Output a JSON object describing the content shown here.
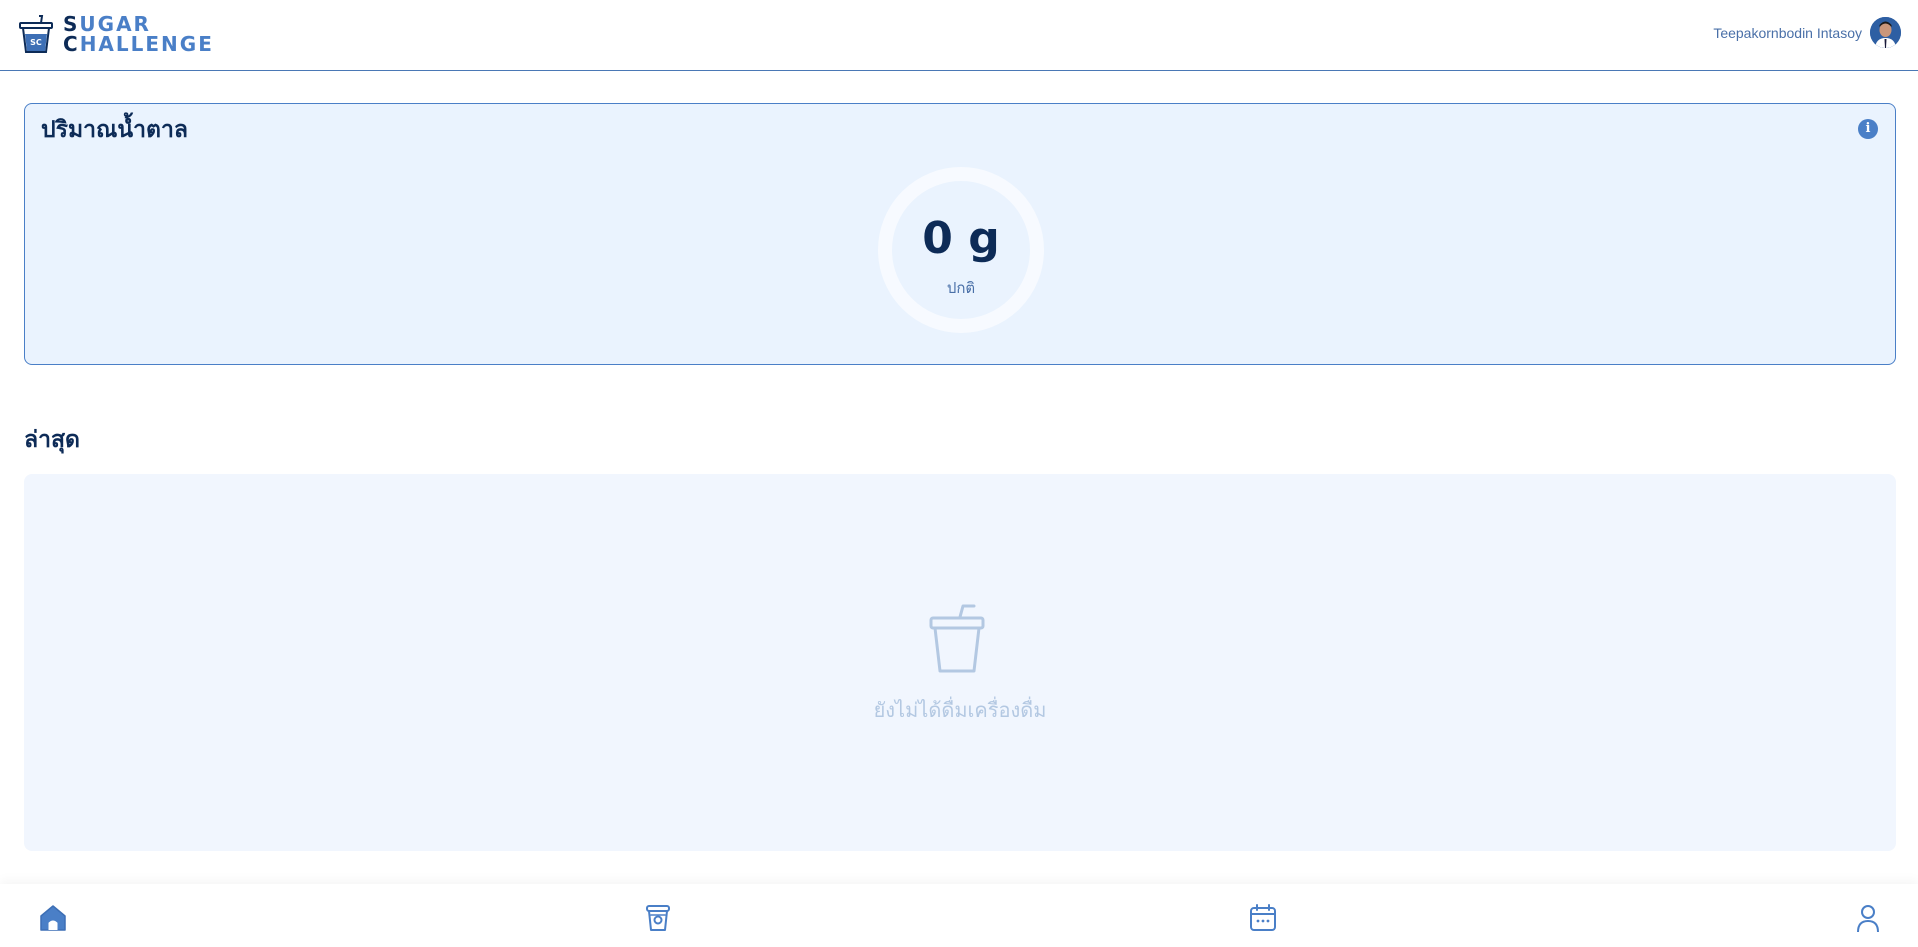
{
  "app": {
    "logo_line1": "SUGAR",
    "logo_line2": "CHALLENGE",
    "logo_badge": "SC"
  },
  "user": {
    "name": "Teepakornbodin Intasoy"
  },
  "sugar_card": {
    "title": "ปริมาณน้ำตาล",
    "value": "0 g",
    "status": "ปกติ"
  },
  "latest": {
    "title": "ล่าสุด",
    "empty_message": "ยังไม่ได้ดื่มเครื่องดื่ม"
  },
  "bottom_nav": {
    "items": [
      {
        "icon": "home-icon",
        "active": true
      },
      {
        "icon": "drink-icon",
        "active": false
      },
      {
        "icon": "calendar-icon",
        "active": false
      },
      {
        "icon": "profile-icon",
        "active": false
      }
    ]
  },
  "colors": {
    "primary_dark": "#0d2b57",
    "primary": "#4a7fc7",
    "card_bg": "#eaf3fe",
    "panel_bg": "#f1f6fe"
  }
}
